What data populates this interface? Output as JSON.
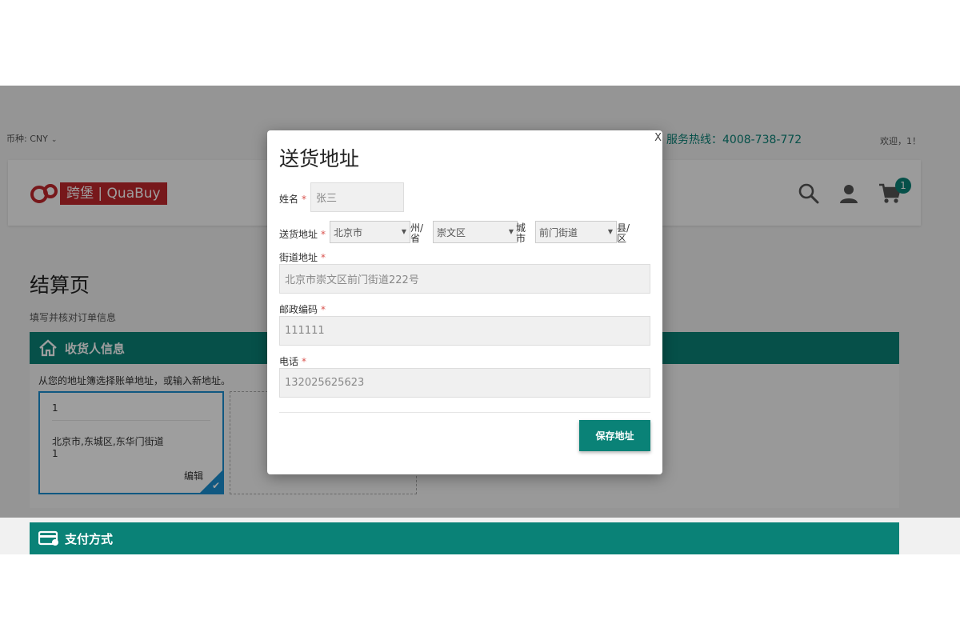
{
  "topbar": {
    "currency_label": "币种: CNY",
    "hotline": "服务热线：4008-738-772",
    "welcome": "欢迎，1！"
  },
  "header": {
    "logo_text": "跨堡 | QuaBuy",
    "cart_count": "1",
    "icons": [
      "search-icon",
      "user-icon",
      "cart-icon"
    ]
  },
  "page": {
    "title": "结算页",
    "subtitle": "填写并核对订单信息"
  },
  "recipient_section": {
    "title": "收货人信息",
    "hint": "从您的地址簿选择账单地址，或输入新地址。",
    "card": {
      "name": "1",
      "address": "北京市,东城区,东华门街道",
      "extra": "1",
      "edit_label": "编辑"
    }
  },
  "payment_section": {
    "title": "支付方式"
  },
  "modal": {
    "title": "送货地址",
    "close_label": "X",
    "name_label": "姓名",
    "name_value": "张三",
    "address_label": "送货地址",
    "province": "北京市",
    "province_unit": "州/省",
    "city": "崇文区",
    "city_unit": "城市",
    "district": "前门街道",
    "district_unit": "县/区",
    "street_label": "街道地址",
    "street_value": "北京市崇文区前门街道222号",
    "postal_label": "邮政编码",
    "postal_value": "111111",
    "phone_label": "电话",
    "phone_value": "132025625623",
    "save_label": "保存地址"
  },
  "colors": {
    "accent": "#0a8277",
    "brand_red": "#c0272d",
    "selection_blue": "#1a8fd0"
  }
}
